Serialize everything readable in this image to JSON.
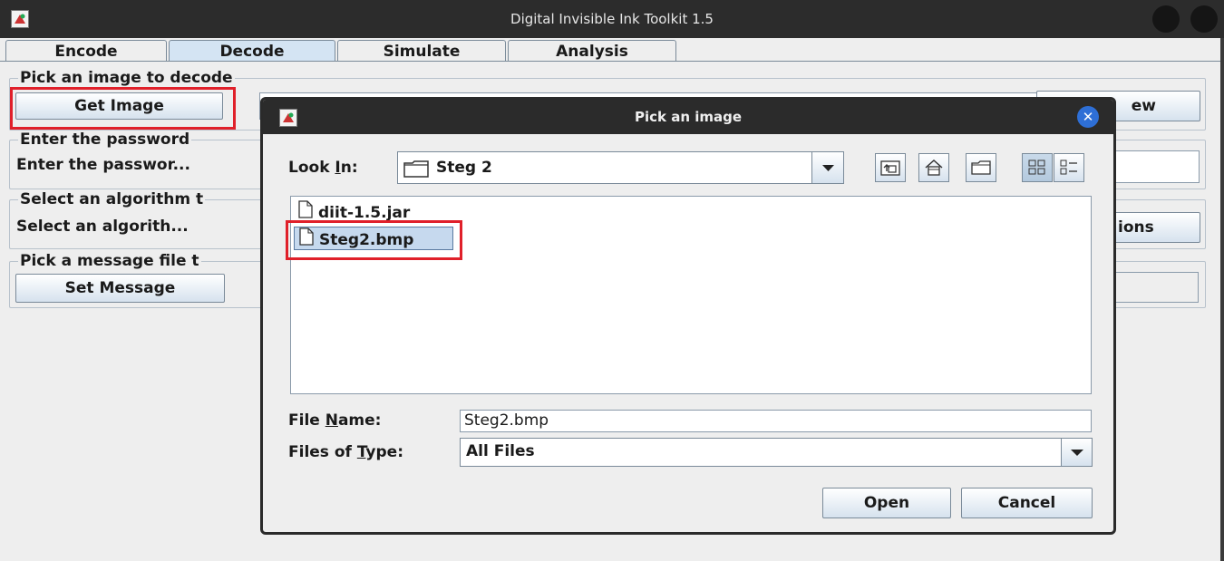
{
  "window": {
    "title": "Digital Invisible Ink Toolkit 1.5"
  },
  "tabs": [
    {
      "label": "Encode",
      "selected": false
    },
    {
      "label": "Decode",
      "selected": true
    },
    {
      "label": "Simulate",
      "selected": false
    },
    {
      "label": "Analysis",
      "selected": false
    }
  ],
  "decode_panel": {
    "image_group": {
      "title": "Pick an image to decode",
      "button": "Get Image",
      "right_button_partial": "ew"
    },
    "password_group": {
      "title": "Enter the password",
      "field_label": "Enter the passwor..."
    },
    "algorithm_group": {
      "title": "Select an algorithm t",
      "field_label": "Select an algorith...",
      "right_button_partial": "ions"
    },
    "message_group": {
      "title": "Pick a message file t",
      "button": "Set Message"
    }
  },
  "dialog": {
    "title": "Pick an image",
    "look_in": {
      "label_pre": "Look ",
      "label_mnemonic": "I",
      "label_post": "n:",
      "value": "Steg 2"
    },
    "toolbar_icons": [
      "up-folder-icon",
      "home-icon",
      "new-folder-icon",
      "list-view-icon",
      "details-view-icon"
    ],
    "files": [
      {
        "name": "diit-1.5.jar",
        "selected": false
      },
      {
        "name": "Steg2.bmp",
        "selected": true
      }
    ],
    "file_name": {
      "label_pre": "File ",
      "label_mnemonic": "N",
      "label_post": "ame:",
      "value": "Steg2.bmp"
    },
    "files_of_type": {
      "label_pre": "Files of ",
      "label_mnemonic": "T",
      "label_post": "ype:",
      "value": "All Files"
    },
    "open_button": "Open",
    "cancel_button": "Cancel"
  },
  "colors": {
    "highlight": "#e0202a",
    "selected_tab": "#d4e4f3",
    "selection": "#c6d9ee",
    "close_button": "#2e6fd6"
  }
}
